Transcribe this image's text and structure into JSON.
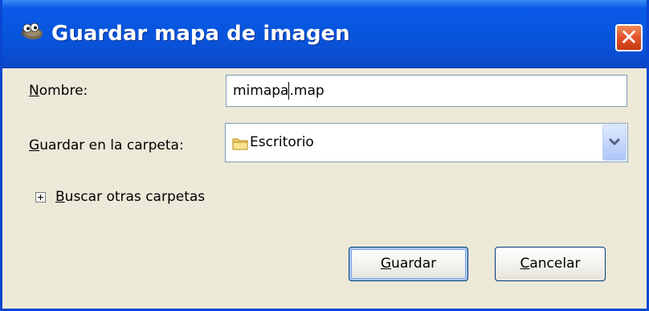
{
  "window": {
    "title": "Guardar mapa de imagen",
    "icon": "gimp-wilber-icon",
    "close_label": "✕"
  },
  "form": {
    "name_label_mnemonic": "N",
    "name_label_rest": "ombre:",
    "name_value_before_cursor": "mimapa",
    "name_value_after_cursor": ".map",
    "folder_label_mnemonic": "G",
    "folder_label_rest": "uardar en la carpeta:",
    "folder_value": "Escritorio",
    "folder_icon": "folder-icon"
  },
  "expander": {
    "label_mnemonic": "B",
    "label_rest": "uscar otras carpetas",
    "state": "collapsed"
  },
  "buttons": {
    "save_mnemonic": "G",
    "save_rest": "uardar",
    "cancel_mnemonic": "C",
    "cancel_rest": "ancelar"
  },
  "colors": {
    "titlebar": "#0855dd",
    "dialog_bg": "#ece9d8",
    "close_button": "#e0522a",
    "input_border": "#7f9db9"
  }
}
